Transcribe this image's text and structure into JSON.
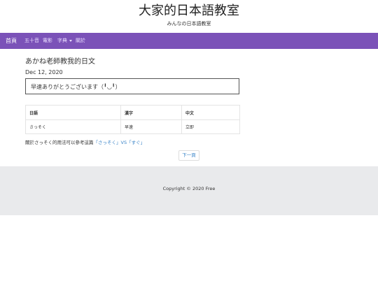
{
  "site": {
    "title": "大家的日本語教室",
    "subtitle": "みんなの日本語教室"
  },
  "nav": {
    "items": [
      {
        "label": "首頁",
        "active": true
      },
      {
        "label": "五十音"
      },
      {
        "label": "電影"
      },
      {
        "label": "字典",
        "dropdown": true
      },
      {
        "label": "關於"
      }
    ]
  },
  "post": {
    "title": "あかね老師教我的日文",
    "date": "Dec 12, 2020",
    "quote": "早速ありがとうございます（╹◡╹）"
  },
  "vocab_table": {
    "headers": [
      "日語",
      "漢字",
      "中文"
    ],
    "rows": [
      [
        "さっそく",
        "早速",
        "立即"
      ]
    ]
  },
  "note": {
    "prefix": "關於さっそく的用法可以參考這篇",
    "link": "「さっそく」VS「すぐ」"
  },
  "pagination": {
    "next_label": "下一頁"
  },
  "footer": {
    "copyright": "Copyright © 2020 Free"
  }
}
